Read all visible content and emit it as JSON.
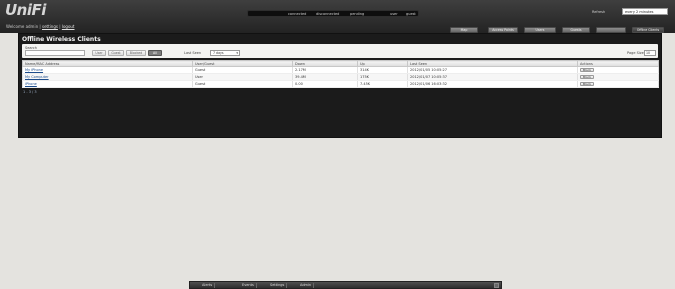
{
  "app": {
    "logo_text": "UniFi",
    "welcome_prefix": "Welcome admin",
    "settings_link": "settings",
    "logout_link": "logout"
  },
  "stats": {
    "connected": "connected",
    "disconnected": "disconnected",
    "pending": "pending",
    "user": "user",
    "guest": "guest"
  },
  "refresh": {
    "label": "Refresh",
    "value": "every 2 minutes"
  },
  "nav_buttons": [
    "Map",
    "Access Points",
    "Users",
    "Guests",
    "Offline Clients"
  ],
  "panel": {
    "title": "Offline Wireless Clients",
    "search_label": "Search",
    "search_value": "",
    "filters": [
      "User",
      "Guest",
      "Blocked",
      "All"
    ],
    "active_filter": "All",
    "last_seen_label": "Last Seen",
    "last_seen_value": "7 days",
    "page_size_label": "Page Size",
    "page_size_value": "10"
  },
  "table": {
    "columns": [
      "Name/MAC Address",
      "User/Guest",
      "Down",
      "Up",
      "Last Seen",
      "Actions"
    ],
    "rows": [
      {
        "name": "My iPhone",
        "type": "Guest",
        "down": "2.17M",
        "up": "314K",
        "last_seen": "2012/01/05 10:05:27",
        "action": "Block"
      },
      {
        "name": "My Computer",
        "type": "User",
        "down": "39.4M",
        "up": "175K",
        "last_seen": "2012/01/07 10:05:37",
        "action": "Block"
      },
      {
        "name": "iPhone",
        "type": "Guest",
        "down": "0.00",
        "up": "7.45K",
        "last_seen": "2012/01/06 16:03:32",
        "action": "Block"
      }
    ],
    "pager": "1 - 3 / 3"
  },
  "bottom_tabs": [
    "Alerts",
    "Events",
    "Settings",
    "Admin"
  ]
}
